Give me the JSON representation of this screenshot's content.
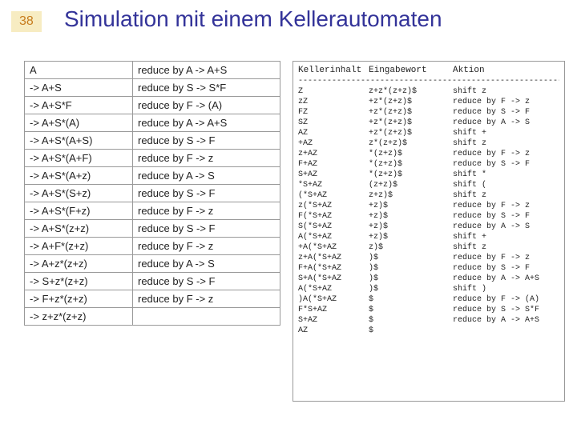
{
  "page_number": "38",
  "title": "Simulation mit einem Kellerautomaten",
  "left_table": {
    "rows": [
      {
        "left": "   A",
        "right": "reduce by A -> A+S"
      },
      {
        "left": "-> A+S",
        "right": "reduce by S -> S*F"
      },
      {
        "left": "-> A+S*F",
        "right": "reduce by F -> (A)"
      },
      {
        "left": "-> A+S*(A)",
        "right": "reduce by A -> A+S"
      },
      {
        "left": "-> A+S*(A+S)",
        "right": "reduce by S -> F"
      },
      {
        "left": "-> A+S*(A+F)",
        "right": "reduce by F -> z"
      },
      {
        "left": "-> A+S*(A+z)",
        "right": "reduce by A -> S"
      },
      {
        "left": "-> A+S*(S+z)",
        "right": "reduce by S -> F"
      },
      {
        "left": "-> A+S*(F+z)",
        "right": "reduce by F -> z"
      },
      {
        "left": "-> A+S*(z+z)",
        "right": "reduce by S -> F"
      },
      {
        "left": "-> A+F*(z+z)",
        "right": "reduce by F -> z"
      },
      {
        "left": "-> A+z*(z+z)",
        "right": "reduce by A -> S"
      },
      {
        "left": "-> S+z*(z+z)",
        "right": "reduce by S -> F"
      },
      {
        "left": "-> F+z*(z+z)",
        "right": "reduce by F -> z"
      },
      {
        "left": "-> z+z*(z+z)",
        "right": ""
      }
    ]
  },
  "right_panel": {
    "headers": {
      "col1": "Kellerinhalt",
      "col2": "Eingabewort",
      "col3": "Aktion"
    },
    "dashes": "------------------------------------------------------------------------------------------",
    "rows": [
      {
        "c1": "Z",
        "c2": "z+z*(z+z)$",
        "c3": "shift z"
      },
      {
        "c1": "zZ",
        "c2": "+z*(z+z)$",
        "c3": "reduce by F -> z"
      },
      {
        "c1": "FZ",
        "c2": "+z*(z+z)$",
        "c3": "reduce by S -> F"
      },
      {
        "c1": "SZ",
        "c2": "+z*(z+z)$",
        "c3": "reduce by A -> S"
      },
      {
        "c1": "AZ",
        "c2": "+z*(z+z)$",
        "c3": "shift +"
      },
      {
        "c1": "+AZ",
        "c2": "z*(z+z)$",
        "c3": "shift z"
      },
      {
        "c1": "z+AZ",
        "c2": "*(z+z)$",
        "c3": "reduce by F -> z"
      },
      {
        "c1": "F+AZ",
        "c2": "*(z+z)$",
        "c3": "reduce by S -> F"
      },
      {
        "c1": "S+AZ",
        "c2": "*(z+z)$",
        "c3": "shift *"
      },
      {
        "c1": "*S+AZ",
        "c2": "(z+z)$",
        "c3": "shift ("
      },
      {
        "c1": "(*S+AZ",
        "c2": "z+z)$",
        "c3": "shift z"
      },
      {
        "c1": "z(*S+AZ",
        "c2": "+z)$",
        "c3": "reduce by F -> z"
      },
      {
        "c1": "F(*S+AZ",
        "c2": "+z)$",
        "c3": "reduce by S -> F"
      },
      {
        "c1": "S(*S+AZ",
        "c2": "+z)$",
        "c3": "reduce by A -> S"
      },
      {
        "c1": "A(*S+AZ",
        "c2": "+z)$",
        "c3": "shift +"
      },
      {
        "c1": "+A(*S+AZ",
        "c2": "z)$",
        "c3": "shift z"
      },
      {
        "c1": "z+A(*S+AZ",
        "c2": ")$",
        "c3": "reduce by F -> z"
      },
      {
        "c1": "F+A(*S+AZ",
        "c2": ")$",
        "c3": "reduce by S -> F"
      },
      {
        "c1": "S+A(*S+AZ",
        "c2": ")$",
        "c3": "reduce by A -> A+S"
      },
      {
        "c1": "A(*S+AZ",
        "c2": ")$",
        "c3": "shift )"
      },
      {
        "c1": ")A(*S+AZ",
        "c2": "$",
        "c3": "reduce by F -> (A)"
      },
      {
        "c1": "F*S+AZ",
        "c2": "$",
        "c3": "reduce by S -> S*F"
      },
      {
        "c1": "S+AZ",
        "c2": "$",
        "c3": "reduce by A -> A+S"
      },
      {
        "c1": "AZ",
        "c2": "$",
        "c3": ""
      }
    ]
  }
}
